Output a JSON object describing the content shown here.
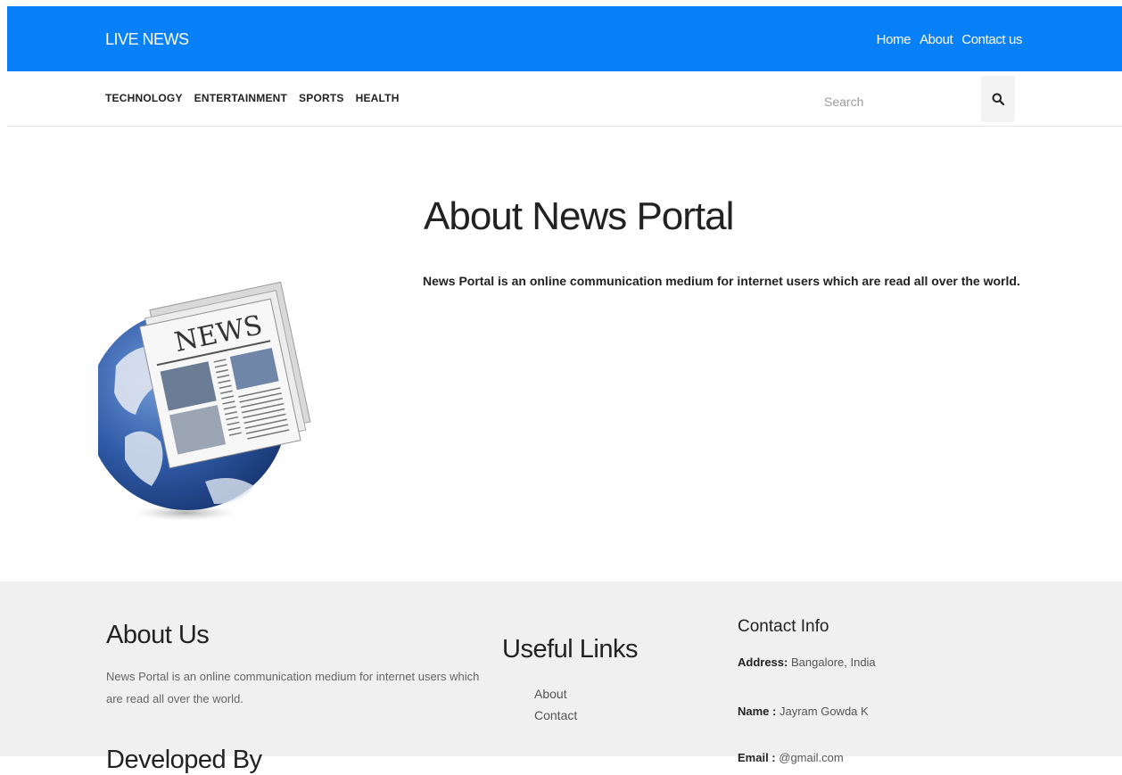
{
  "header": {
    "brand": "LIVE NEWS",
    "nav": [
      "Home",
      "About",
      "Contact us"
    ],
    "background": "#0880f7"
  },
  "categories": [
    "TECHNOLOGY",
    "ENTERTAINMENT",
    "SPORTS",
    "HEALTH"
  ],
  "search": {
    "placeholder": "Search",
    "icon": "search-icon"
  },
  "main": {
    "illustration_text": "NEWS",
    "title": "About News Portal",
    "text": "News Portal is an online communication medium for internet users which are read all over the world."
  },
  "footer": {
    "background": "#f0f0f0",
    "about": {
      "title": "About Us",
      "text": "News Portal is an online communication medium for internet users which are read all over the world."
    },
    "developed": {
      "title": "Developed By"
    },
    "links": {
      "title": "Useful Links",
      "items": [
        "About",
        "Contact"
      ]
    },
    "contact": {
      "title": "Contact Info",
      "address_label": "Address:",
      "address": "Bangalore, India",
      "name_label": "Name :",
      "name": "Jayram Gowda K",
      "email_label": "Email :",
      "email": "@gmail.com"
    }
  }
}
